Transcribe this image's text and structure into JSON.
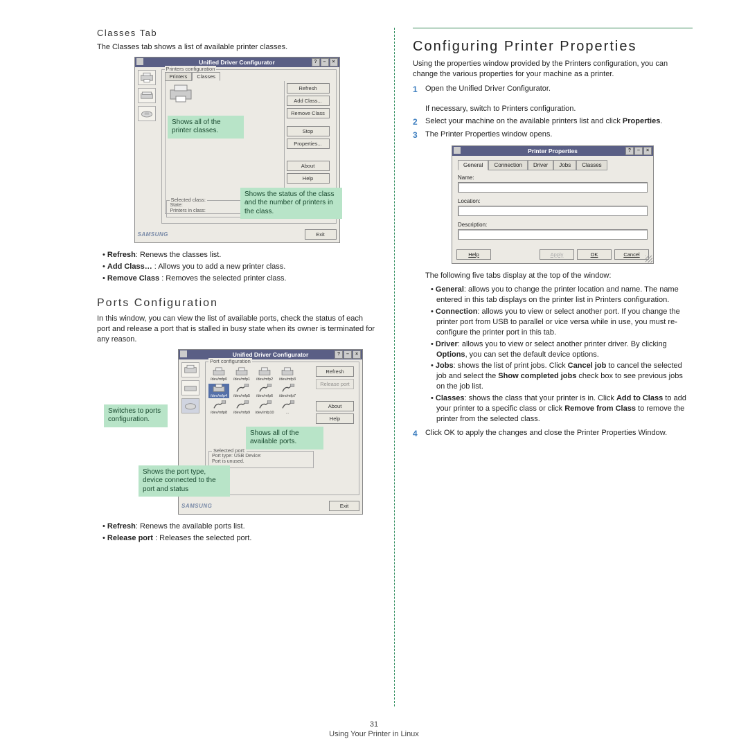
{
  "left": {
    "classes_tab": {
      "heading": "Classes Tab",
      "intro": "The Classes tab shows a list of available printer classes.",
      "dlg_title": "Unified Driver Configurator",
      "group_label": "Printers configuration",
      "tab_printers": "Printers",
      "tab_classes": "Classes",
      "btn_refresh": "Refresh",
      "btn_addclass": "Add Class...",
      "btn_removeclass": "Remove Class",
      "btn_stop": "Stop",
      "btn_properties": "Properties...",
      "btn_about": "About",
      "btn_help": "Help",
      "selected_label": "Selected class:",
      "state_label": "State:",
      "printers_label": "Printers in class:",
      "exit_label": "Exit",
      "logo": "SAMSUNG",
      "callout_left": "Shows all of the printer classes.",
      "callout_right": "Shows the status of the class and the number of printers in the class.",
      "bullets": [
        {
          "b": "Refresh",
          "t": ": Renews the classes list."
        },
        {
          "b": "Add Class…",
          "t": " : Allows you to add a new printer class."
        },
        {
          "b": "Remove Class",
          "t": " : Removes the selected printer class."
        }
      ]
    },
    "ports": {
      "heading": "Ports Configuration",
      "intro": "In this window, you can view the list of available ports, check the status of each port and release a port that is stalled in busy state when its owner is terminated for any reason.",
      "dlg_title": "Unified Driver Configurator",
      "group_label": "Port configuration",
      "btn_refresh": "Refresh",
      "btn_release": "Release port",
      "btn_about": "About",
      "btn_help": "Help",
      "selected_label": "Selected port:",
      "porttype_label": "Port type: USB  Device:",
      "portstate_label": "Port is unused.",
      "exit_label": "Exit",
      "logo": "SAMSUNG",
      "port_labels": [
        "/dev/mfp0",
        "/dev/mfp1",
        "/dev/mfp2",
        "/dev/mfp3",
        "/dev/mfp4",
        "/dev/mfp5",
        "/dev/mfp6",
        "/dev/mfp7",
        "/dev/mfp8",
        "/dev/mfp9",
        "/dev/mfp10",
        "..."
      ],
      "callout_switch": "Switches to ports configuration.",
      "callout_ports": "Shows all of the available ports.",
      "callout_status": "Shows the port type, device connected to the port and status",
      "bullets": [
        {
          "b": "Refresh",
          "t": ": Renews the available ports list."
        },
        {
          "b": "Release port",
          "t": " : Releases the selected port."
        }
      ]
    }
  },
  "right": {
    "heading": "Configuring Printer Properties",
    "intro": "Using the properties window provided by the Printers configuration, you can change the various properties for your machine as a printer.",
    "steps_top": [
      {
        "n": "1",
        "t1": "Open the Unified Driver Configurator.",
        "t2": "If necessary, switch to Printers configuration."
      },
      {
        "n": "2",
        "t": "Select your machine on the available printers list and click ",
        "b": "Properties",
        "t2": "."
      },
      {
        "n": "3",
        "t": "The Printer Properties window opens."
      }
    ],
    "pp": {
      "title": "Printer Properties",
      "tabs": [
        "General",
        "Connection",
        "Driver",
        "Jobs",
        "Classes"
      ],
      "lbl_name": "Name:",
      "lbl_location": "Location:",
      "lbl_desc": "Description:",
      "btn_help": "Help",
      "btn_apply": "Apply",
      "btn_ok": "OK",
      "btn_cancel": "Cancel"
    },
    "after_pp1": "The following five tabs display at the top of the window:",
    "tab_desc": [
      {
        "b": "General",
        "t": ": allows you to change the printer location and name. The name entered in this tab displays on the printer list in Printers configuration."
      },
      {
        "b": "Connection",
        "t": ": allows you to view or select another port. If you change the printer port from USB to parallel or vice versa while in use, you must re-configure the printer port in this tab."
      },
      {
        "b": "Driver",
        "t": ": allows you to view or select another printer driver. By clicking <b>Options</b>, you can set the default device options."
      },
      {
        "b": "Jobs",
        "t": ": shows the list of print jobs. Click <b>Cancel job</b> to cancel the selected job and select the <b>Show completed jobs</b> check box to see previous jobs on the job list."
      },
      {
        "b": "Classes",
        "t": ": shows the class that your printer is in. Click <b>Add to Class</b> to add your printer to a specific class or click <b>Remove from Class</b> to remove the printer from the selected class."
      }
    ],
    "step4": {
      "n": "4",
      "t": "Click OK to apply the changes and close the Printer Properties Window."
    }
  },
  "footer": {
    "page": "31",
    "section": "Using Your Printer in Linux"
  }
}
